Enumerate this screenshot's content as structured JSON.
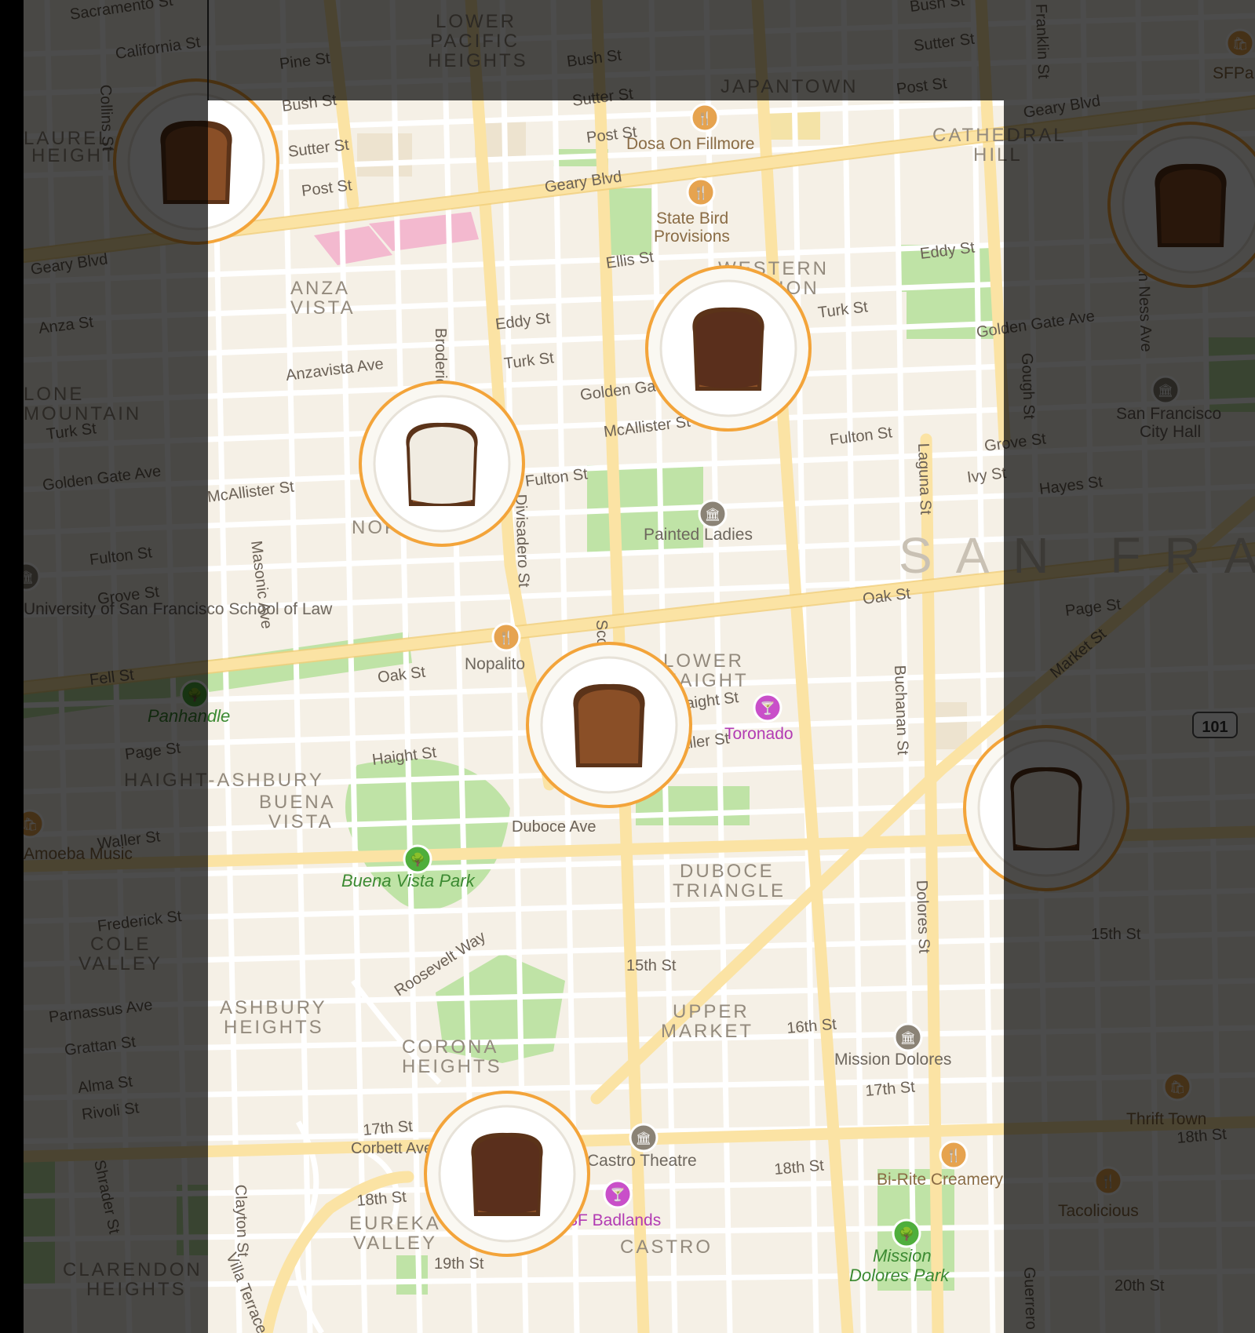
{
  "map": {
    "city_label": "SAN FRANCISCO",
    "neighborhoods": [
      {
        "id": "lower-pacific",
        "text": "LOWER"
      },
      {
        "id": "lower-pacific-2",
        "text": "PACIFIC"
      },
      {
        "id": "lower-pacific-3",
        "text": "HEIGHTS"
      },
      {
        "id": "japantown",
        "text": "JAPANTOWN"
      },
      {
        "id": "cathedral",
        "text": "CATHEDRAL"
      },
      {
        "id": "cathedral-2",
        "text": "HILL"
      },
      {
        "id": "anza",
        "text": "ANZA"
      },
      {
        "id": "anza-2",
        "text": "VISTA"
      },
      {
        "id": "western",
        "text": "WESTERN"
      },
      {
        "id": "western-2",
        "text": "ADDITION"
      },
      {
        "id": "nopa",
        "text": "NOPA"
      },
      {
        "id": "lower-haight",
        "text": "LOWER"
      },
      {
        "id": "lower-haight-2",
        "text": "HAIGHT"
      },
      {
        "id": "haight-ashbury",
        "text": "HAIGHT-ASHBURY"
      },
      {
        "id": "buena",
        "text": "BUENA"
      },
      {
        "id": "buena-2",
        "text": "VISTA"
      },
      {
        "id": "duboce",
        "text": "DUBOCE"
      },
      {
        "id": "duboce-2",
        "text": "TRIANGLE"
      },
      {
        "id": "cole",
        "text": "COLE"
      },
      {
        "id": "cole-2",
        "text": "VALLEY"
      },
      {
        "id": "ashbury",
        "text": "ASHBURY"
      },
      {
        "id": "ashbury-2",
        "text": "HEIGHTS"
      },
      {
        "id": "corona",
        "text": "CORONA"
      },
      {
        "id": "corona-2",
        "text": "HEIGHTS"
      },
      {
        "id": "upper",
        "text": "UPPER"
      },
      {
        "id": "upper-2",
        "text": "MARKET"
      },
      {
        "id": "eureka",
        "text": "EUREKA"
      },
      {
        "id": "eureka-2",
        "text": "VALLEY"
      },
      {
        "id": "castro",
        "text": "CASTRO"
      },
      {
        "id": "clarendon",
        "text": "CLARENDON"
      },
      {
        "id": "clarendon-2",
        "text": "HEIGHTS"
      },
      {
        "id": "laurel",
        "text": "LAUREL"
      },
      {
        "id": "laurel-2",
        "text": "HEIGHTS"
      },
      {
        "id": "lone",
        "text": "LONE"
      },
      {
        "id": "lone-2",
        "text": "MOUNTAIN"
      }
    ],
    "streets": [
      {
        "id": "sacramento",
        "text": "Sacramento St"
      },
      {
        "id": "california",
        "text": "California St"
      },
      {
        "id": "pine",
        "text": "Pine St"
      },
      {
        "id": "bush",
        "text": "Bush St"
      },
      {
        "id": "bush-2",
        "text": "Bush St"
      },
      {
        "id": "bush-3",
        "text": "Bush St"
      },
      {
        "id": "sutter",
        "text": "Sutter St"
      },
      {
        "id": "sutter-2",
        "text": "Sutter St"
      },
      {
        "id": "sutter-3",
        "text": "Sutter St"
      },
      {
        "id": "post",
        "text": "Post St"
      },
      {
        "id": "post-2",
        "text": "Post St"
      },
      {
        "id": "post-3",
        "text": "Post St"
      },
      {
        "id": "geary",
        "text": "Geary Blvd"
      },
      {
        "id": "geary-2",
        "text": "Geary Blvd"
      },
      {
        "id": "geary-3",
        "text": "Geary Blvd"
      },
      {
        "id": "ellis",
        "text": "Ellis St"
      },
      {
        "id": "eddy",
        "text": "Eddy St"
      },
      {
        "id": "eddy-2",
        "text": "Eddy St"
      },
      {
        "id": "turk",
        "text": "Turk St"
      },
      {
        "id": "turk-2",
        "text": "Turk St"
      },
      {
        "id": "turk-3",
        "text": "Turk St"
      },
      {
        "id": "golden-gate",
        "text": "Golden Gate Ave"
      },
      {
        "id": "golden-gate-2",
        "text": "Golden Gate Ave"
      },
      {
        "id": "golden-gate-3",
        "text": "Golden Gate Ave"
      },
      {
        "id": "anza-st",
        "text": "Anza St"
      },
      {
        "id": "anzavista",
        "text": "Anzavista Ave"
      },
      {
        "id": "mcallister",
        "text": "McAllister St"
      },
      {
        "id": "mcallister-2",
        "text": "McAllister St"
      },
      {
        "id": "fulton",
        "text": "Fulton St"
      },
      {
        "id": "fulton-2",
        "text": "Fulton St"
      },
      {
        "id": "fulton-3",
        "text": "Fulton St"
      },
      {
        "id": "grove",
        "text": "Grove St"
      },
      {
        "id": "grove-2",
        "text": "Grove St"
      },
      {
        "id": "hayes",
        "text": "Hayes St"
      },
      {
        "id": "ivy",
        "text": "Ivy St"
      },
      {
        "id": "oak",
        "text": "Oak St"
      },
      {
        "id": "oak-2",
        "text": "Oak St"
      },
      {
        "id": "fell",
        "text": "Fell St"
      },
      {
        "id": "page",
        "text": "Page St"
      },
      {
        "id": "page-2",
        "text": "Page St"
      },
      {
        "id": "haight",
        "text": "Haight St"
      },
      {
        "id": "haight-2",
        "text": "Haight St"
      },
      {
        "id": "waller",
        "text": "Waller St"
      },
      {
        "id": "waller-2",
        "text": "Waller St"
      },
      {
        "id": "duboce",
        "text": "Duboce Ave"
      },
      {
        "id": "frederick",
        "text": "Frederick St"
      },
      {
        "id": "parnassus",
        "text": "Parnassus Ave"
      },
      {
        "id": "grattan",
        "text": "Grattan St"
      },
      {
        "id": "alma",
        "text": "Alma St"
      },
      {
        "id": "rivoli",
        "text": "Rivoli St"
      },
      {
        "id": "roosevelt",
        "text": "Roosevelt Way"
      },
      {
        "id": "fifteenth",
        "text": "15th St"
      },
      {
        "id": "fifteenth-2",
        "text": "15th St"
      },
      {
        "id": "sixteenth",
        "text": "16th St"
      },
      {
        "id": "seventeenth",
        "text": "17th St"
      },
      {
        "id": "seventeenth-2",
        "text": "17th St"
      },
      {
        "id": "eighteenth",
        "text": "18th St"
      },
      {
        "id": "eighteenth-2",
        "text": "18th St"
      },
      {
        "id": "eighteenth-3",
        "text": "18th St"
      },
      {
        "id": "nineteenth",
        "text": "19th St"
      },
      {
        "id": "twentieth",
        "text": "20th St"
      },
      {
        "id": "corbett",
        "text": "Corbett Ave"
      },
      {
        "id": "market",
        "text": "Market St"
      },
      {
        "id": "masonic",
        "text": "Masonic Ave"
      },
      {
        "id": "broderick",
        "text": "Broderick St"
      },
      {
        "id": "divisadero",
        "text": "Divisadero St"
      },
      {
        "id": "scott",
        "text": "Scott St"
      },
      {
        "id": "laguna",
        "text": "Laguna St"
      },
      {
        "id": "buchanan",
        "text": "Buchanan St"
      },
      {
        "id": "dolores",
        "text": "Dolores St"
      },
      {
        "id": "gough",
        "text": "Gough St"
      },
      {
        "id": "van-ness",
        "text": "Van Ness Ave"
      },
      {
        "id": "franklin",
        "text": "Franklin St"
      },
      {
        "id": "clayton",
        "text": "Clayton St"
      },
      {
        "id": "shrader",
        "text": "Shrader St"
      },
      {
        "id": "collins",
        "text": "Collins St"
      },
      {
        "id": "guerrero",
        "text": "Guerrero St"
      },
      {
        "id": "villa",
        "text": "Villa Terrace"
      }
    ],
    "pois": [
      {
        "id": "dosa",
        "text": "Dosa On Fillmore",
        "kind": "restaurant"
      },
      {
        "id": "state-bird",
        "text": "State Bird",
        "kind": "restaurant"
      },
      {
        "id": "state-bird-2",
        "text": "Provisions",
        "kind": "restaurant"
      },
      {
        "id": "painted-ladies",
        "text": "Painted Ladies",
        "kind": "landmark"
      },
      {
        "id": "nopalito",
        "text": "Nopalito",
        "kind": "restaurant"
      },
      {
        "id": "toronado",
        "text": "Toronado",
        "kind": "bar"
      },
      {
        "id": "panhandle",
        "text": "Panhandle",
        "kind": "park"
      },
      {
        "id": "buena-vista-park",
        "text": "Buena Vista Park",
        "kind": "park"
      },
      {
        "id": "mission-dolores",
        "text": "Mission Dolores",
        "kind": "landmark"
      },
      {
        "id": "castro-theatre",
        "text": "Castro Theatre",
        "kind": "landmark"
      },
      {
        "id": "sf-badlands",
        "text": "SF Badlands",
        "kind": "bar"
      },
      {
        "id": "bi-rite",
        "text": "Bi-Rite Creamery",
        "kind": "restaurant"
      },
      {
        "id": "mission-dolores-park",
        "text": "Mission",
        "kind": "park"
      },
      {
        "id": "mission-dolores-park-2",
        "text": "Dolores Park",
        "kind": "park"
      },
      {
        "id": "sf-city-hall",
        "text": "San Francisco",
        "kind": "landmark"
      },
      {
        "id": "sf-city-hall-2",
        "text": "City Hall",
        "kind": "landmark"
      },
      {
        "id": "thrift-town",
        "text": "Thrift Town",
        "kind": "shop"
      },
      {
        "id": "tacolicious",
        "text": "Tacolicious",
        "kind": "restaurant"
      },
      {
        "id": "amoeba",
        "text": "Amoeba Music",
        "kind": "shop"
      },
      {
        "id": "usf-law",
        "text": "University of San Francisco School of Law",
        "kind": "landmark"
      },
      {
        "id": "sfpark",
        "text": "SFPa",
        "kind": "shop"
      },
      {
        "id": "highway",
        "text": "101",
        "kind": "shield"
      }
    ],
    "toast_pins": [
      {
        "name": "toast-pin-plain-upper-left",
        "topping": "plain"
      },
      {
        "name": "toast-pin-nutella-western-addition",
        "topping": "nutella"
      },
      {
        "name": "toast-pin-plain-right-edge",
        "topping": "plain"
      },
      {
        "name": "toast-pin-butter-nopa",
        "topping": "butter"
      },
      {
        "name": "toast-pin-plain-lower-haight",
        "topping": "plain"
      },
      {
        "name": "toast-pin-butter-right-edge",
        "topping": "butter"
      },
      {
        "name": "toast-pin-nutella-eureka-valley",
        "topping": "nutella"
      }
    ]
  },
  "colors": {
    "land": "#f5f0e6",
    "park": "#bfe3a6",
    "major_road": "#fbe3a4",
    "minor_road": "#ffffff",
    "pin_ring": "#f3a43a",
    "plate": "#faf8f2",
    "overlay": "rgba(0,0,0,0.70)"
  }
}
